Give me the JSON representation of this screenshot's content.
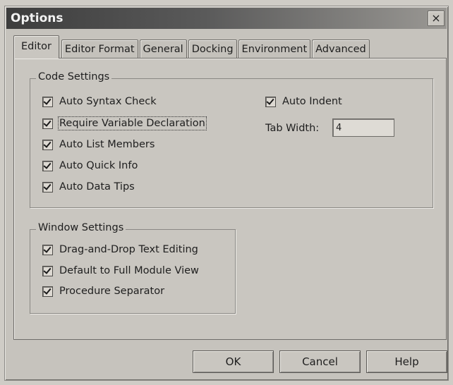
{
  "window": {
    "title": "Options",
    "close_glyph": "×"
  },
  "tabs": [
    {
      "label": "Editor",
      "active": true
    },
    {
      "label": "Editor Format"
    },
    {
      "label": "General"
    },
    {
      "label": "Docking"
    },
    {
      "label": "Environment"
    },
    {
      "label": "Advanced"
    }
  ],
  "code_settings": {
    "legend": "Code Settings",
    "options": [
      {
        "label": "Auto Syntax Check",
        "checked": true
      },
      {
        "label": "Require Variable Declaration",
        "checked": true
      },
      {
        "label": "Auto List Members",
        "checked": true
      },
      {
        "label": "Auto Quick Info",
        "checked": true
      },
      {
        "label": "Auto Data Tips",
        "checked": true
      }
    ],
    "auto_indent": {
      "label": "Auto Indent",
      "checked": true
    },
    "tab_width": {
      "label": "Tab Width:",
      "value": "4"
    }
  },
  "window_settings": {
    "legend": "Window Settings",
    "options": [
      {
        "label": "Drag-and-Drop Text Editing",
        "checked": true
      },
      {
        "label": "Default to Full Module View",
        "checked": true
      },
      {
        "label": "Procedure Separator",
        "checked": true
      }
    ]
  },
  "buttons": {
    "ok": "OK",
    "cancel": "Cancel",
    "help": "Help"
  }
}
